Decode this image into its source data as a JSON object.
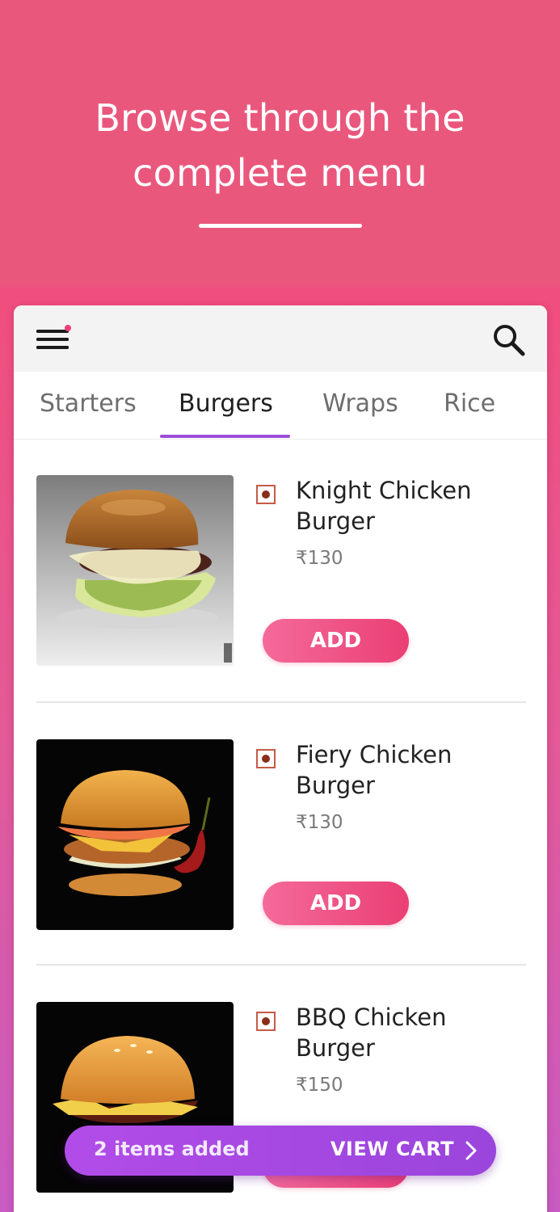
{
  "hero": {
    "title_line1": "Browse through the",
    "title_line2": "complete menu"
  },
  "appbar": {
    "menu_icon": "hamburger-menu-icon",
    "search_icon": "search-icon",
    "notification_dot_color": "#ea3f75"
  },
  "tabs": [
    {
      "label": "Starters",
      "active": false
    },
    {
      "label": "Burgers",
      "active": true
    },
    {
      "label": "Wraps",
      "active": false
    },
    {
      "label": "Rice",
      "active": false
    }
  ],
  "items": [
    {
      "name_line1": "Knight Chicken",
      "name_line2": "Burger",
      "price": "₹130",
      "add_label": "ADD"
    },
    {
      "name_line1": "Fiery Chicken",
      "name_line2": "Burger",
      "price": "₹130",
      "add_label": "ADD"
    },
    {
      "name_line1": "BBQ Chicken",
      "name_line2": "Burger",
      "price": "₹150",
      "add_label": "ADD"
    }
  ],
  "cart": {
    "count_text": "2 items added",
    "view_label": "VIEW CART"
  },
  "colors": {
    "brand_pink": "#ea577c",
    "accent_purple": "#9b4ed6",
    "add_button": "#ea3f75"
  }
}
